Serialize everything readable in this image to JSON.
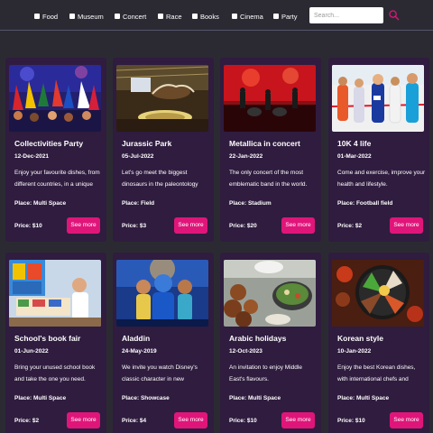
{
  "nav": {
    "filters": [
      "Food",
      "Museum",
      "Concert",
      "Race",
      "Books",
      "Cinema",
      "Party"
    ],
    "search_placeholder": "Search...",
    "search_icon": "search-icon",
    "accent": "#e0157a"
  },
  "cards": [
    {
      "title": "Collectivities Party",
      "date": "12-Dec-2021",
      "desc": "Enjoy your favourite dishes, from different countries, in a unique event for the whole family.",
      "place": "Place: Multi Space",
      "price": "Price: $10",
      "button": "See more"
    },
    {
      "title": "Jurassic Park",
      "date": "05-Jul-2022",
      "desc": "Let's go meet the biggest dinosaurs in the paleontology museum.",
      "place": "Place: Field",
      "price": "Price: $3",
      "button": "See more"
    },
    {
      "title": "Metallica in concert",
      "date": "22-Jan-2022",
      "desc": "The only concert of the most emblematic band in the world.",
      "place": "Place: Stadium",
      "price": "Price: $20",
      "button": "See more"
    },
    {
      "title": "10K 4 life",
      "date": "01-Mar-2022",
      "desc": "Come and exercise, improve your health and lifestyle.",
      "place": "Place: Football field",
      "price": "Price: $2",
      "button": "See more"
    },
    {
      "title": "School's book fair",
      "date": "01-Jun-2022",
      "desc": "Bring your unused school book and take the one you need.",
      "place": "Place: Multi Space",
      "price": "Price: $2",
      "button": "See more"
    },
    {
      "title": "Aladdin",
      "date": "24-May-2019",
      "desc": "We invite you watch Disney's classic character in new adventures.",
      "place": "Place: Showcase",
      "price": "Price: $4",
      "button": "See more"
    },
    {
      "title": "Arabic holidays",
      "date": "12-Oct-2023",
      "desc": "An invitation to enjoy Middle East's flavours.",
      "place": "Place: Multi Space",
      "price": "Price: $10",
      "button": "See more"
    },
    {
      "title": "Korean style",
      "date": "10-Jan-2022",
      "desc": "Enjoy the best Korean dishes, with international chefs and awesome events.",
      "place": "Place: Multi Space",
      "price": "Price: $10",
      "button": "See more"
    }
  ]
}
